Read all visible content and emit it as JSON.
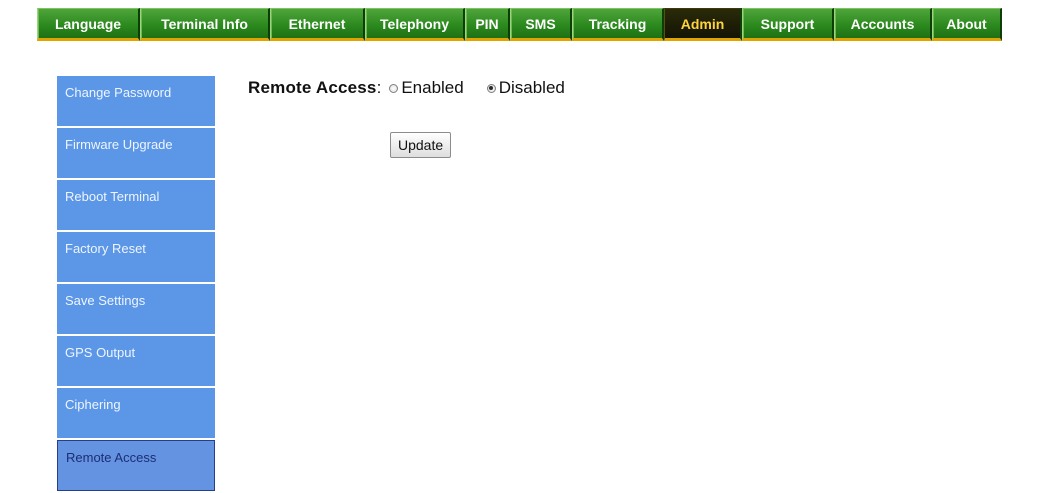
{
  "nav": {
    "tabs": [
      {
        "label": "Language"
      },
      {
        "label": "Terminal Info"
      },
      {
        "label": "Ethernet"
      },
      {
        "label": "Telephony"
      },
      {
        "label": "PIN"
      },
      {
        "label": "SMS"
      },
      {
        "label": "Tracking"
      },
      {
        "label": "Admin"
      },
      {
        "label": "Support"
      },
      {
        "label": "Accounts"
      },
      {
        "label": "About"
      }
    ],
    "active": "Admin"
  },
  "sidebar": {
    "items": [
      {
        "label": "Change Password"
      },
      {
        "label": "Firmware Upgrade"
      },
      {
        "label": "Reboot Terminal"
      },
      {
        "label": "Factory Reset"
      },
      {
        "label": "Save Settings"
      },
      {
        "label": "GPS Output"
      },
      {
        "label": "Ciphering"
      },
      {
        "label": "Remote Access"
      }
    ],
    "active": "Remote Access"
  },
  "main": {
    "remote_access": {
      "label": "Remote Access",
      "colon": ":",
      "options": [
        {
          "label": "Enabled",
          "checked": false
        },
        {
          "label": "Disabled",
          "checked": true
        }
      ]
    },
    "update_label": "Update"
  },
  "colors": {
    "tab_green": "#2c8a1e",
    "tab_active_bg": "#141404",
    "tab_active_text": "#ffd33d",
    "tab_underline": "#e0a400",
    "sidebar_blue": "#5b96e7",
    "sidebar_active_text": "#1c2f73"
  }
}
